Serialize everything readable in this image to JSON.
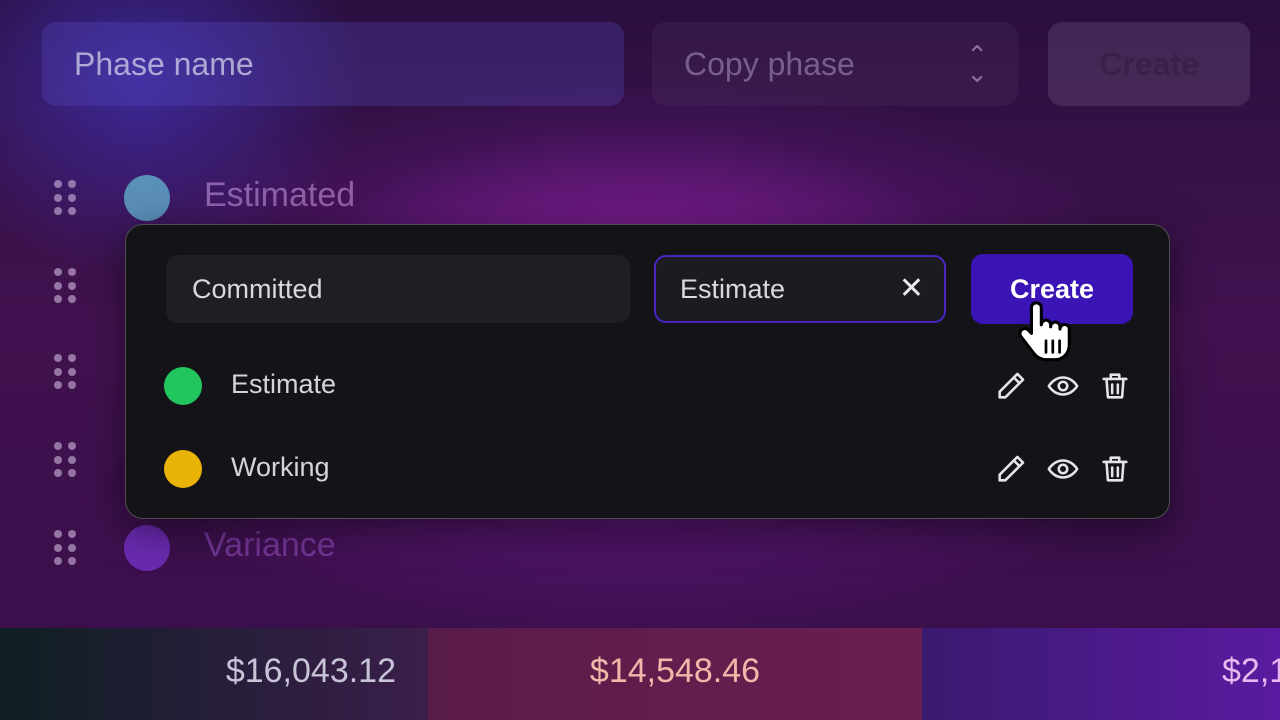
{
  "background_form": {
    "phase_name_placeholder": "Phase name",
    "copy_phase_placeholder": "Copy phase",
    "create_label": "Create",
    "rows": [
      {
        "label": "Estimated",
        "color": "#5a8fb8"
      },
      {
        "label": "",
        "color": "#7a3aa8"
      },
      {
        "label": "",
        "color": "#7a3aa8"
      },
      {
        "label": "",
        "color": "#7a3aa8"
      },
      {
        "label": "Variance",
        "color": "#6a2ab0"
      }
    ]
  },
  "totals": {
    "first": "$16,043.12",
    "second": "$14,548.46",
    "third": "$2,1"
  },
  "popover": {
    "name_value": "Committed",
    "copy_value": "Estimate",
    "create_label": "Create",
    "phases": [
      {
        "label": "Estimate",
        "color": "#22c55e"
      },
      {
        "label": "Working",
        "color": "#eab308"
      }
    ]
  },
  "icons": {
    "edit": "pencil-icon",
    "view": "eye-icon",
    "delete": "trash-icon",
    "clear": "close-icon",
    "drag": "drag-handle-icon",
    "cursor": "hand-pointer-icon"
  },
  "colors": {
    "accent": "#3a14b4",
    "card_bg": "#141418"
  }
}
